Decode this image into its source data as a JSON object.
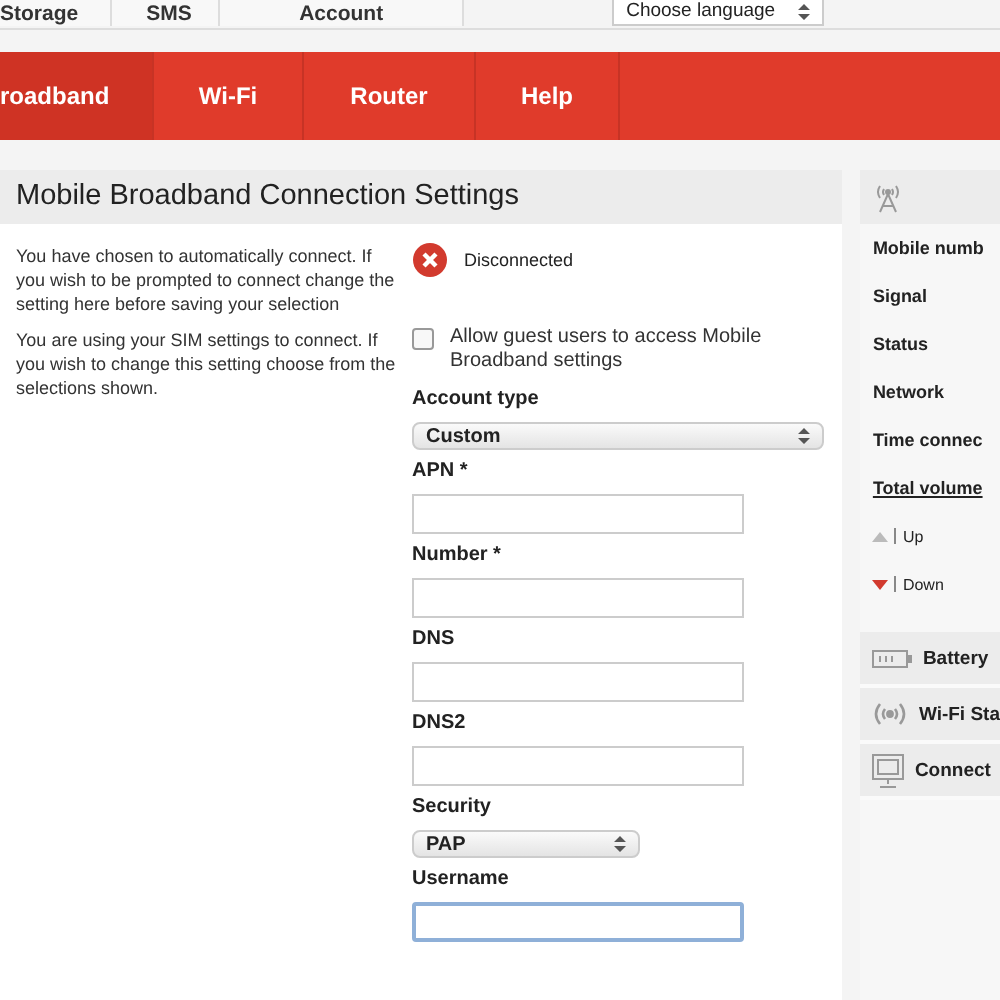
{
  "top_tabs": [
    {
      "label": "Storage"
    },
    {
      "label": "SMS"
    },
    {
      "label": "Account"
    }
  ],
  "language_select": {
    "value": "Choose language"
  },
  "nav": [
    {
      "label": "roadband",
      "selected": true
    },
    {
      "label": "Wi-Fi",
      "selected": false
    },
    {
      "label": "Router",
      "selected": false
    },
    {
      "label": "Help",
      "selected": false
    }
  ],
  "title": "Mobile Broadband Connection Settings",
  "notes": [
    "You have chosen to automatically connect. If you wish to be prompted to connect change the setting here before saving your selection",
    "You are using your SIM settings to connect. If you wish to change this setting choose from the selections shown."
  ],
  "connection_status": {
    "kind": "disconnected",
    "label": "Disconnected"
  },
  "guest_access": {
    "label": "Allow guest users to access Mobile Broadband settings",
    "checked": false
  },
  "fields": [
    {
      "kind": "select",
      "label": "Account type",
      "value": "Custom",
      "wide": true
    },
    {
      "kind": "text",
      "label": "APN *",
      "focused": false
    },
    {
      "kind": "text",
      "label": "Number *",
      "focused": false
    },
    {
      "kind": "text",
      "label": "DNS",
      "focused": false
    },
    {
      "kind": "text",
      "label": "DNS2",
      "focused": false
    },
    {
      "kind": "select",
      "label": "Security",
      "value": "PAP",
      "wide": false
    },
    {
      "kind": "text",
      "label": "Username",
      "focused": true
    }
  ],
  "sidebar": {
    "rows": [
      {
        "kind": "label",
        "text": "Mobile numb"
      },
      {
        "kind": "label",
        "text": "Signal"
      },
      {
        "kind": "label",
        "text": "Status"
      },
      {
        "kind": "label",
        "text": "Network"
      },
      {
        "kind": "label",
        "text": "Time connec"
      },
      {
        "kind": "link",
        "text": "Total volume"
      },
      {
        "kind": "up",
        "text": "Up"
      },
      {
        "kind": "down",
        "text": "Down"
      }
    ],
    "sections": [
      {
        "kind": "battery",
        "label": "Battery"
      },
      {
        "kind": "wifi",
        "label": "Wi-Fi Sta"
      },
      {
        "kind": "monitor",
        "label": "Connect"
      }
    ]
  }
}
